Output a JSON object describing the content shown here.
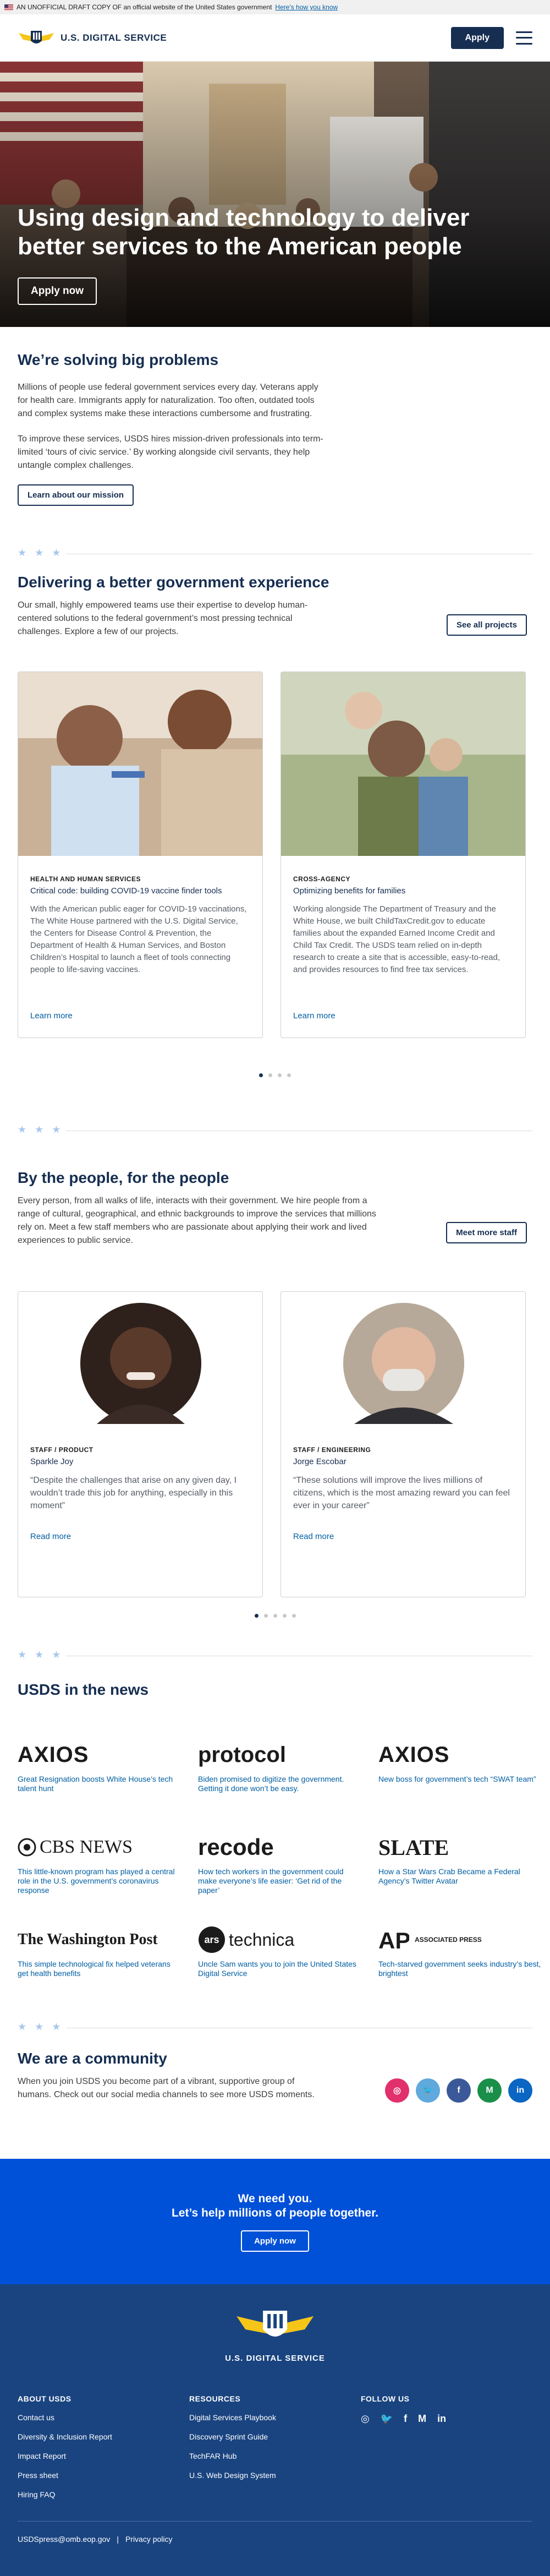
{
  "banner": {
    "text": "AN UNOFFICIAL DRAFT COPY OF an official website of the United States government",
    "link": "Here's how you know"
  },
  "header": {
    "logo_text": "U.S. DIGITAL SERVICE",
    "apply_label": "Apply"
  },
  "hero": {
    "title": "Using design and technology to deliver better services to the American people",
    "apply_label": "Apply now"
  },
  "problems": {
    "title": "We’re solving big problems",
    "p1": "Millions of people use federal government services every day. Veterans apply for health care. Immigrants apply for naturalization. Too often, outdated tools and complex systems make these interactions cumbersome and frustrating.",
    "p2": "To improve these services, USDS hires mission-driven professionals into term-limited ‘tours of civic service.’ By working alongside civil servants, they help untangle complex challenges.",
    "button": "Learn about our mission"
  },
  "experience": {
    "title": "Delivering a better government experience",
    "text": "Our small, highly empowered teams use their expertise to develop human-centered solutions to the federal government’s most pressing technical challenges. Explore a few of our projects.",
    "button": "See all projects",
    "cards": [
      {
        "tag": "HEALTH AND HUMAN SERVICES",
        "subtitle": "Critical code: building COVID-19 vaccine finder tools",
        "text": "With the American public eager for COVID-19 vaccinations, The White House partnered with the U.S. Digital Service, the Centers for Disease Control & Prevention, the Department of Health & Human Services, and Boston Children’s Hospital to launch a fleet of tools connecting people to life-saving vaccines.",
        "link": "Learn more"
      },
      {
        "tag": "CROSS-AGENCY",
        "subtitle": "Optimizing benefits for families",
        "text": "Working alongside The Department of Treasury and the White House, we built ChildTaxCredit.gov to educate families about the expanded Earned Income Credit and Child Tax Credit. The USDS team relied on in-depth research to create a site that is accessible, easy-to-read, and provides resources to find free tax services.",
        "link": "Learn more"
      }
    ]
  },
  "people": {
    "title": "By the people, for the people",
    "text": "Every person, from all walks of life, interacts with their government. We hire people from a range of cultural, geographical, and ethnic backgrounds to improve the services that millions rely on. Meet a few staff members who are passionate about applying their work and lived experiences to public service.",
    "button": "Meet more staff",
    "cards": [
      {
        "tag": "STAFF / PRODUCT",
        "name": "Sparkle Joy",
        "quote": "“Despite the challenges that arise on any given day, I wouldn’t trade this job for anything, especially in this moment”",
        "link": "Read more"
      },
      {
        "tag": "STAFF / ENGINEERING",
        "name": "Jorge Escobar",
        "quote": "“These solutions will improve the lives millions of citizens, which is the most amazing reward you can feel ever in your career”",
        "link": "Read more"
      }
    ]
  },
  "news": {
    "title": "USDS in the news",
    "items": [
      {
        "logo": "AXIOS",
        "text": "Great Resignation boosts White House’s tech talent hunt"
      },
      {
        "logo": "protocol",
        "text": "Biden promised to digitize the government. Getting it done won’t be easy."
      },
      {
        "logo": "AXIOS",
        "text": "New boss for government’s tech “SWAT team”"
      },
      {
        "logo": "CBS NEWS",
        "text": "This little-known program has played a central role in the U.S. government’s coronavirus response"
      },
      {
        "logo": "recode",
        "text": "How tech workers in the government could make everyone’s life easier: ‘Get rid of the paper’"
      },
      {
        "logo": "SLATE",
        "text": "How a Star Wars Crab Became a Federal Agency’s Twitter Avatar"
      },
      {
        "logo": "The Washington Post",
        "text": "This simple technological fix helped veterans get health benefits"
      },
      {
        "logo": "technica",
        "text": "Uncle Sam wants you to join the United States Digital Service"
      },
      {
        "logo": "ASSOCIATED PRESS",
        "text": "Tech-starved government seeks industry’s best, brightest"
      }
    ]
  },
  "community": {
    "title": "We are a community",
    "text": "When you join USDS you become part of a vibrant, supportive group of humans. Check out our social media channels to see more USDS moments."
  },
  "cta": {
    "line1": "We need you.",
    "line2": "Let’s help millions of people together.",
    "button": "Apply now"
  },
  "footer": {
    "logo_text": "U.S. DIGITAL SERVICE",
    "about_heading": "ABOUT USDS",
    "about_links": [
      "Contact us",
      "Diversity & Inclusion Report",
      "Impact Report",
      "Press sheet",
      "Hiring FAQ"
    ],
    "resources_heading": "RESOURCES",
    "resources_links": [
      "Digital Services Playbook",
      "Discovery Sprint Guide",
      "TechFAR Hub",
      "U.S. Web Design System"
    ],
    "follow_heading": "FOLLOW US",
    "email": "USDSpress@omb.eop.gov",
    "privacy": "Privacy policy"
  }
}
